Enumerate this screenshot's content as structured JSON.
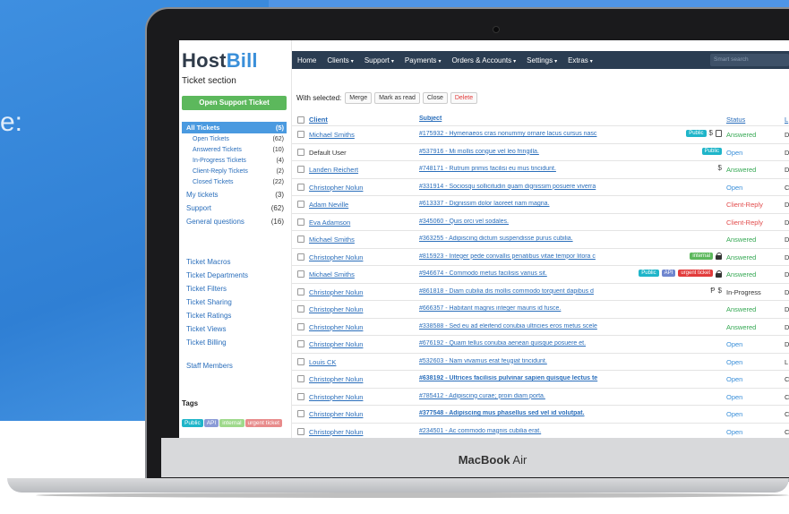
{
  "hero_text": "e:",
  "laptop_brand": {
    "bold": "MacBook",
    "light": " Air"
  },
  "app": {
    "logo_part1": "Host",
    "logo_part2": "Bill",
    "section_title": "Ticket section",
    "open_ticket_button": "Open Support Ticket"
  },
  "sidebar": {
    "nav": [
      {
        "label": "All Tickets",
        "count": "(5)",
        "kind": "active"
      },
      {
        "label": "Open Tickets",
        "count": "(62)",
        "kind": "sub"
      },
      {
        "label": "Answered Tickets",
        "count": "(10)",
        "kind": "sub"
      },
      {
        "label": "In-Progress Tickets",
        "count": "(4)",
        "kind": "sub"
      },
      {
        "label": "Client-Reply Tickets",
        "count": "(2)",
        "kind": "sub"
      },
      {
        "label": "Closed Tickets",
        "count": "(22)",
        "kind": "sub"
      },
      {
        "label": "My tickets",
        "count": "(3)",
        "kind": "top"
      },
      {
        "label": "Support",
        "count": "(62)",
        "kind": "top"
      },
      {
        "label": "General questions",
        "count": "(16)",
        "kind": "top"
      }
    ],
    "links": [
      "Ticket Macros",
      "Ticket Departments",
      "Ticket Filters",
      "Ticket Sharing",
      "Ticket Ratings",
      "Ticket Views",
      "Ticket Billing"
    ],
    "staff_members": "Staff Members",
    "tags_title": "Tags",
    "tags": [
      {
        "label": "Public",
        "color": "#1fb5c9"
      },
      {
        "label": "API",
        "color": "#8a9bd6"
      },
      {
        "label": "internal",
        "color": "#9ed98b"
      },
      {
        "label": "urgent ticket",
        "color": "#e88b8b"
      }
    ]
  },
  "topnav": {
    "items": [
      {
        "label": "Home",
        "caret": ""
      },
      {
        "label": "Clients",
        "caret": "▾"
      },
      {
        "label": "Support",
        "caret": "▾"
      },
      {
        "label": "Payments",
        "caret": "▾"
      },
      {
        "label": "Orders & Accounts",
        "caret": "▾"
      },
      {
        "label": "Settings",
        "caret": "▾"
      },
      {
        "label": "Extras",
        "caret": "▾"
      }
    ],
    "search_placeholder": "Smart search"
  },
  "toolbar": {
    "with_selected": "With selected:",
    "buttons": [
      "Merge",
      "Mark as read",
      "Close",
      "Delete"
    ]
  },
  "table": {
    "headers": {
      "client": "Client",
      "subject": "Subject",
      "status": "Status",
      "last": "L"
    },
    "rows": [
      {
        "client": "Michael Smiths",
        "link": true,
        "subject": "#175932 - Hymenaeos cras nonummy ornare lacus cursus nasc",
        "bold": false,
        "tags": [
          "Public",
          "$",
          "note"
        ],
        "status": "Answered",
        "status_kind": "answered",
        "last": "D"
      },
      {
        "client": "Default User",
        "link": false,
        "subject": "#537916 - Mi mollis congue vel leo fringilla.",
        "bold": false,
        "tags": [
          "Public"
        ],
        "status": "Open",
        "status_kind": "open",
        "last": "D"
      },
      {
        "client": "Landen Reichert",
        "link": true,
        "subject": "#748171 - Rutrum primis facilisi eu mus tincidunt.",
        "bold": false,
        "tags": [
          "$"
        ],
        "status": "Answered",
        "status_kind": "answered",
        "last": "D"
      },
      {
        "client": "Christopher Nolun",
        "link": true,
        "subject": "#331914 - Sociosqu sollicitudin quam dignissim posuere viverra",
        "bold": false,
        "tags": [],
        "status": "Open",
        "status_kind": "open",
        "last": "C"
      },
      {
        "client": "Adam Neville",
        "link": true,
        "subject": "#613337 - Dignissim dolor laoreet nam magna.",
        "bold": false,
        "tags": [],
        "status": "Client-Reply",
        "status_kind": "client",
        "last": "D"
      },
      {
        "client": "Eva Adamson",
        "link": true,
        "subject": "#345060 - Quis orci vel sodales.",
        "bold": false,
        "tags": [],
        "status": "Client-Reply",
        "status_kind": "client",
        "last": "D"
      },
      {
        "client": "Michael Smiths",
        "link": true,
        "subject": "#363255 - Adipiscing dictum suspendisse purus cubilia.",
        "bold": false,
        "tags": [],
        "status": "Answered",
        "status_kind": "answered",
        "last": "D"
      },
      {
        "client": "Christopher Nolun",
        "link": true,
        "subject": "#815923 - Integer pede convallis penatibus vitae tempor litora c",
        "bold": false,
        "tags": [
          "internal",
          "lock"
        ],
        "status": "Answered",
        "status_kind": "answered",
        "last": "D"
      },
      {
        "client": "Michael Smiths",
        "link": true,
        "subject": "#946674 - Commodo metus facilisis varius sit.",
        "bold": false,
        "tags": [
          "Public",
          "API",
          "urgent ticket",
          "lock"
        ],
        "status": "Answered",
        "status_kind": "answered",
        "last": "D"
      },
      {
        "client": "Christopher Nolun",
        "link": true,
        "subject": "#861818 - Diam cubilia dis mollis commodo torquent dapibus d",
        "bold": false,
        "tags": [
          "Ᵽ",
          "$"
        ],
        "status": "In-Progress",
        "status_kind": "progress",
        "last": "D"
      },
      {
        "client": "Christopher Nolun",
        "link": true,
        "subject": "#666357 - Habitant magnis integer mauris id fusce.",
        "bold": false,
        "tags": [],
        "status": "Answered",
        "status_kind": "answered",
        "last": "D"
      },
      {
        "client": "Christopher Nolun",
        "link": true,
        "subject": "#338588 - Sed eu ad eleifend conubia ultricies eros metus scele",
        "bold": false,
        "tags": [],
        "status": "Answered",
        "status_kind": "answered",
        "last": "D"
      },
      {
        "client": "Christopher Nolun",
        "link": true,
        "subject": "#676192 - Quam tellus conubia aenean quisque posuere et.",
        "bold": false,
        "tags": [],
        "status": "Open",
        "status_kind": "open",
        "last": "D"
      },
      {
        "client": "Louis CK",
        "link": true,
        "subject": "#532603 - Nam vivamus erat feugiat tincidunt.",
        "bold": false,
        "tags": [],
        "status": "Open",
        "status_kind": "open",
        "last": "L"
      },
      {
        "client": "Christopher Nolun",
        "link": true,
        "subject": "#638192 - Ultrices facilisis pulvinar sapien quisque lectus te",
        "bold": true,
        "tags": [],
        "status": "Open",
        "status_kind": "open",
        "last": "C"
      },
      {
        "client": "Christopher Nolun",
        "link": true,
        "subject": "#785412 - Adipiscing curae; proin diam porta.",
        "bold": false,
        "tags": [],
        "status": "Open",
        "status_kind": "open",
        "last": "C"
      },
      {
        "client": "Christopher Nolun",
        "link": true,
        "subject": "#377548 - Adipiscing mus phasellus sed vel id volutpat.",
        "bold": true,
        "tags": [],
        "status": "Open",
        "status_kind": "open",
        "last": "C"
      },
      {
        "client": "Christopher Nolun",
        "link": true,
        "subject": "#234501 - Ac commodo magnis cubilia erat.",
        "bold": false,
        "tags": [],
        "status": "Open",
        "status_kind": "open",
        "last": "C"
      }
    ]
  },
  "tag_colors": {
    "Public": "#1fb5c9",
    "API": "#6f86cf",
    "urgent ticket": "#e23b3b",
    "internal": "#5cb85c"
  }
}
